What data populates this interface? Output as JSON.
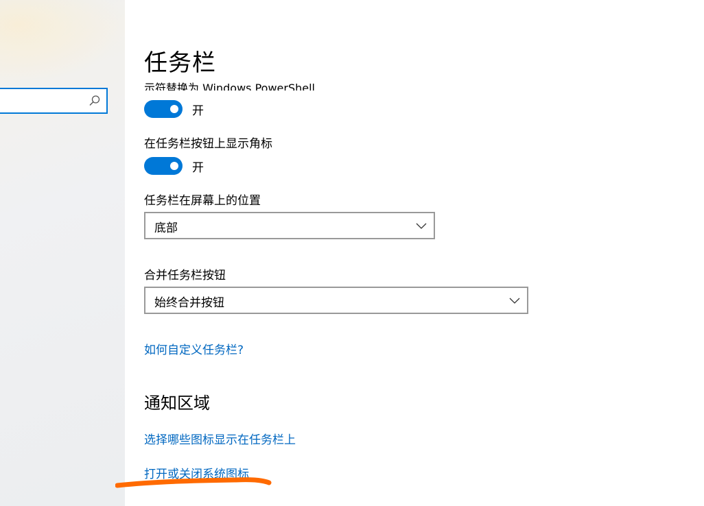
{
  "sidebar": {
    "search": {
      "value": "",
      "placeholder": ""
    }
  },
  "page": {
    "title": "任务栏",
    "clipped_setting_label": "示符替换为 Windows PowerShell"
  },
  "settings": {
    "powershell_toggle": {
      "state_label": "开",
      "on": true
    },
    "badges_toggle": {
      "label": "在任务栏按钮上显示角标",
      "state_label": "开",
      "on": true
    },
    "position": {
      "label": "任务栏在屏幕上的位置",
      "selected": "底部"
    },
    "combine": {
      "label": "合并任务栏按钮",
      "selected": "始终合并按钮"
    },
    "customize_link": "如何自定义任务栏?"
  },
  "notification_area": {
    "title": "通知区域",
    "select_icons_link": "选择哪些图标显示在任务栏上",
    "system_icons_link": "打开或关闭系统图标"
  },
  "colors": {
    "accent": "#0078d7",
    "link": "#0067c0",
    "annotation": "#ff6a00"
  },
  "icons": {
    "search": "search-icon",
    "dropdown": "chevron-down-icon"
  }
}
